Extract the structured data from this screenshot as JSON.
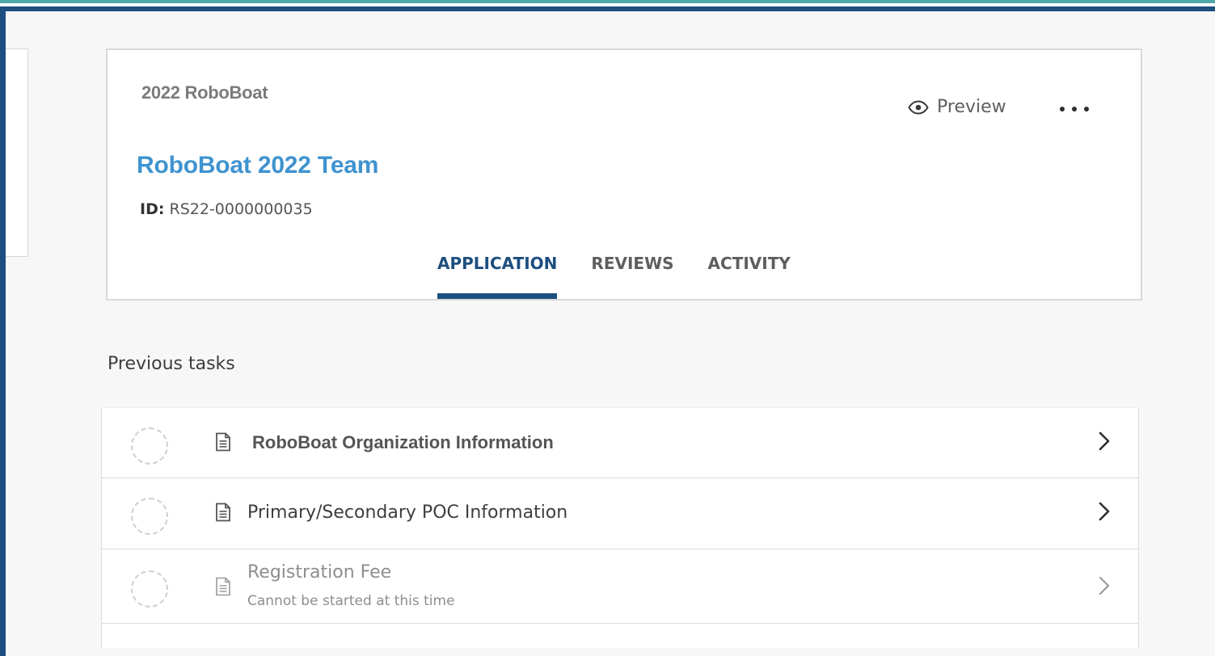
{
  "header": {
    "program_name": "2022 RoboBoat",
    "team_title": "RoboBoat 2022 Team",
    "id_label": "ID:",
    "id_value": "RS22-0000000035",
    "preview_label": "Preview",
    "preview_icon": "eye-icon",
    "more_icon": "more-horizontal-icon"
  },
  "tabs": [
    {
      "label": "APPLICATION",
      "active": true
    },
    {
      "label": "REVIEWS",
      "active": false
    },
    {
      "label": "ACTIVITY",
      "active": false
    }
  ],
  "previous_tasks": {
    "title": "Previous tasks",
    "items": [
      {
        "label": "RoboBoat Organization Information",
        "status": "not-started",
        "icon": "document-icon"
      },
      {
        "label": "Primary/Secondary POC Information",
        "status": "not-started",
        "icon": "document-icon"
      },
      {
        "label": "Registration Fee",
        "sublabel": "Cannot be started at this time",
        "status": "disabled",
        "icon": "document-icon"
      }
    ]
  },
  "colors": {
    "brand_navy": "#1d4e80",
    "accent_teal": "#4fa8a6",
    "title_blue": "#3f93cf"
  }
}
